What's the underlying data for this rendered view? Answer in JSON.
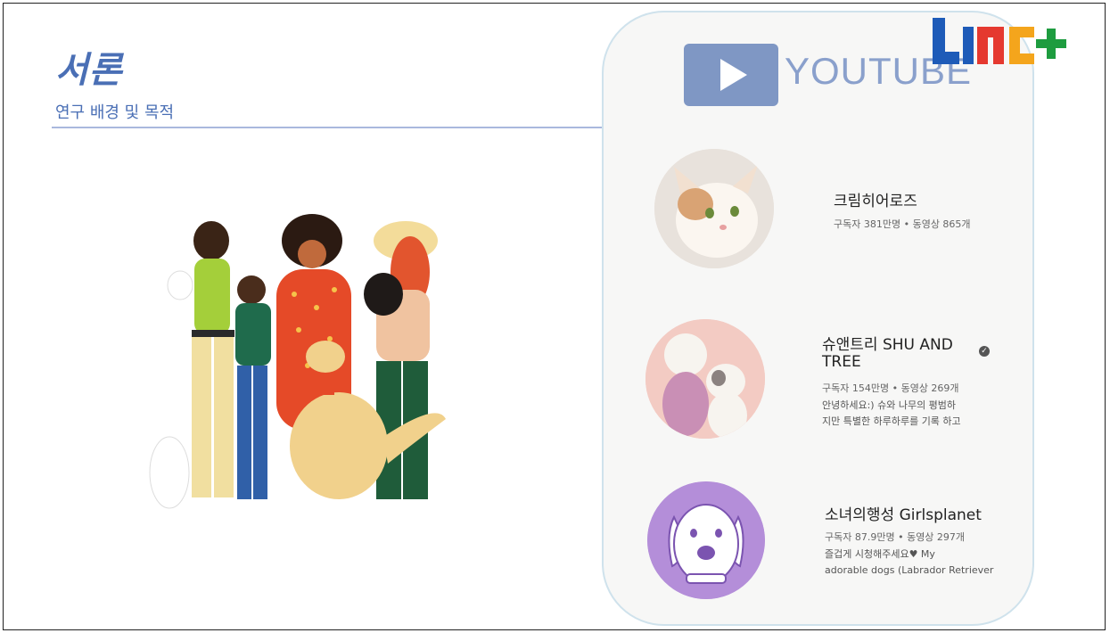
{
  "slide": {
    "title": "서론",
    "subtitle": "연구 배경 및 목적"
  },
  "youtube": {
    "brand": "YOUTUBE",
    "logo_color": "#7f97c4",
    "channels": [
      {
        "name": "크림히어로즈",
        "meta": "구독자 381만명 • 동영상 865개",
        "desc": ""
      },
      {
        "name_line1": "슈앤트리 SHU AND",
        "name_line2": "TREE",
        "meta": "구독자 154만명 • 동영상 269개",
        "desc_line1": "안녕하세요:) 슈와 나무의 평범하",
        "desc_line2": "지만 특별한 하루하루를 기록 하고"
      },
      {
        "name": "소녀의행성 Girlsplanet",
        "meta": "구독자 87.9만명 • 동영상 297개",
        "desc_line1": "즐겁게 시청해주세요♥ My",
        "desc_line2": "adorable dogs (Labrador Retriever"
      }
    ]
  },
  "logo": {
    "text": "LINC+",
    "colors": [
      "#1e5bb8",
      "#e5392f",
      "#f4a51c",
      "#1e9c3f"
    ]
  }
}
